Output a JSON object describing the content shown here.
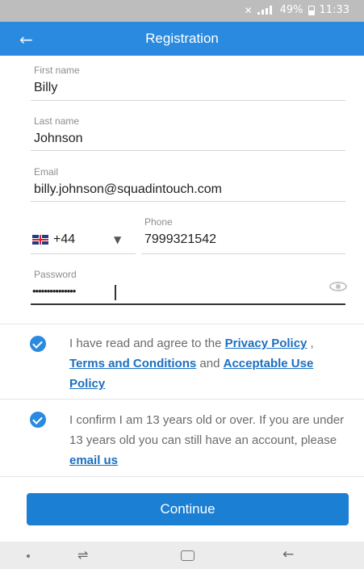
{
  "status_bar": {
    "battery": "49%",
    "time": "11:33"
  },
  "header": {
    "title": "Registration"
  },
  "form": {
    "first_name": {
      "label": "First name",
      "value": "Billy"
    },
    "last_name": {
      "label": "Last name",
      "value": "Johnson"
    },
    "email": {
      "label": "Email",
      "value": "billy.johnson@squadintouch.com"
    },
    "phone": {
      "label": "Phone",
      "country_code": "+44",
      "value": "7999321542"
    },
    "password": {
      "label": "Password",
      "value": "•••••••••••••••"
    }
  },
  "consent_terms": {
    "prefix": "I have read and agree to the ",
    "privacy_link": "Privacy Policy",
    "comma": " , ",
    "terms_link": "Terms and Conditions",
    "and": " and ",
    "aup_link": "Acceptable Use Policy"
  },
  "consent_age": {
    "text": "I confirm I am 13 years old or over. If you are under 13 years old you can still have an account, please ",
    "email_link": "email us"
  },
  "continue_label": "Continue",
  "colors": {
    "primary": "#2a8ae0",
    "link": "#1b6fc0",
    "status_bar": "#bdbdbd"
  }
}
